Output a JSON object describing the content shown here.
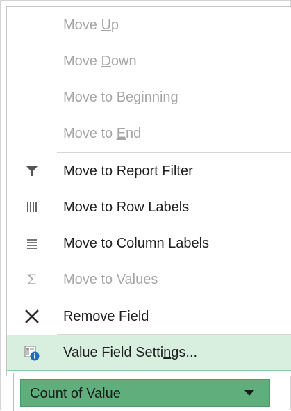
{
  "menu": {
    "items": [
      {
        "pre": "Move ",
        "accel": "U",
        "post": "p",
        "icon": "none",
        "enabled": false
      },
      {
        "pre": "Move ",
        "accel": "D",
        "post": "own",
        "icon": "none",
        "enabled": false
      },
      {
        "pre": "Move to Be",
        "accel": "g",
        "post": "inning",
        "icon": "none",
        "enabled": false
      },
      {
        "pre": "Move to ",
        "accel": "E",
        "post": "nd",
        "icon": "none",
        "enabled": false
      },
      {
        "pre": "Move to Report Filter",
        "accel": "",
        "post": "",
        "icon": "filter-icon",
        "enabled": true
      },
      {
        "pre": "Move to Row Labels",
        "accel": "",
        "post": "",
        "icon": "row-labels-icon",
        "enabled": true
      },
      {
        "pre": "Move to Column Labels",
        "accel": "",
        "post": "",
        "icon": "column-labels-icon",
        "enabled": true
      },
      {
        "pre": "Move to Values",
        "accel": "",
        "post": "",
        "icon": "sigma-icon",
        "enabled": false
      },
      {
        "pre": "Remove Field",
        "accel": "",
        "post": "",
        "icon": "close-x-icon",
        "enabled": true
      },
      {
        "pre": "Value Field Setti",
        "accel": "n",
        "post": "gs...",
        "icon": "field-settings-icon",
        "enabled": true,
        "highlighted": true
      }
    ],
    "sigma_glyph": "Σ"
  },
  "field_bar": {
    "label": "Count of Value",
    "icon": "dropdown-arrow-icon"
  },
  "colors": {
    "highlight_bg": "#d8eedf",
    "field_bar_bg": "#5fae7c",
    "disabled_text": "#a6a6a6"
  }
}
